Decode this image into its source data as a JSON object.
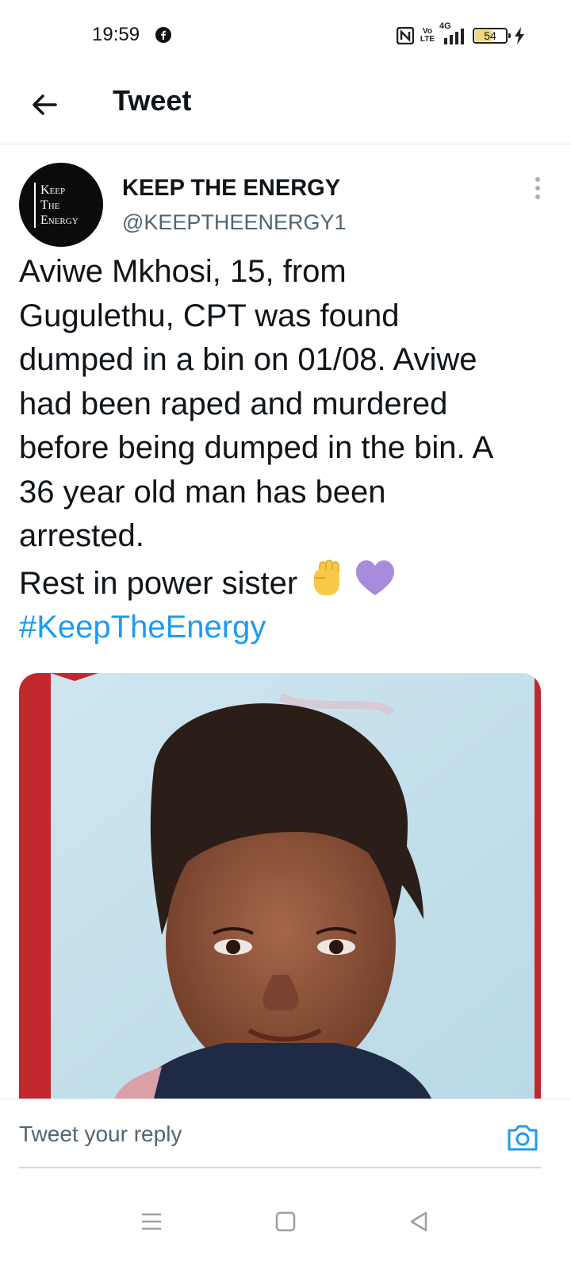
{
  "status_bar": {
    "time": "19:59",
    "battery": "54",
    "network": "4G",
    "volte_top": "Vo",
    "volte_bottom": "LTE"
  },
  "header": {
    "title": "Tweet"
  },
  "tweet": {
    "author_name": "KEEP THE ENERGY",
    "author_handle": "@KEEPTHEENERGY1",
    "avatar_logo_lines": [
      "Keep",
      "The",
      "Energy"
    ],
    "text_lines": [
      "Aviwe Mkhosi, 15, from",
      "Gugulethu, CPT was found",
      "dumped in a bin on 01/08. Aviwe",
      "had been raped and murdered",
      "before being dumped in the bin. A",
      "36 year old man has been",
      "arrested."
    ],
    "closing_line": "Rest in power sister",
    "emojis": [
      "raised-fist-emoji",
      "purple-heart-emoji"
    ],
    "hashtag": "#KeepTheEnergy"
  },
  "reply": {
    "placeholder": "Tweet your reply"
  },
  "colors": {
    "link": "#1d9bf0",
    "secondary_text": "#536471",
    "primary_text": "#0f1419"
  }
}
